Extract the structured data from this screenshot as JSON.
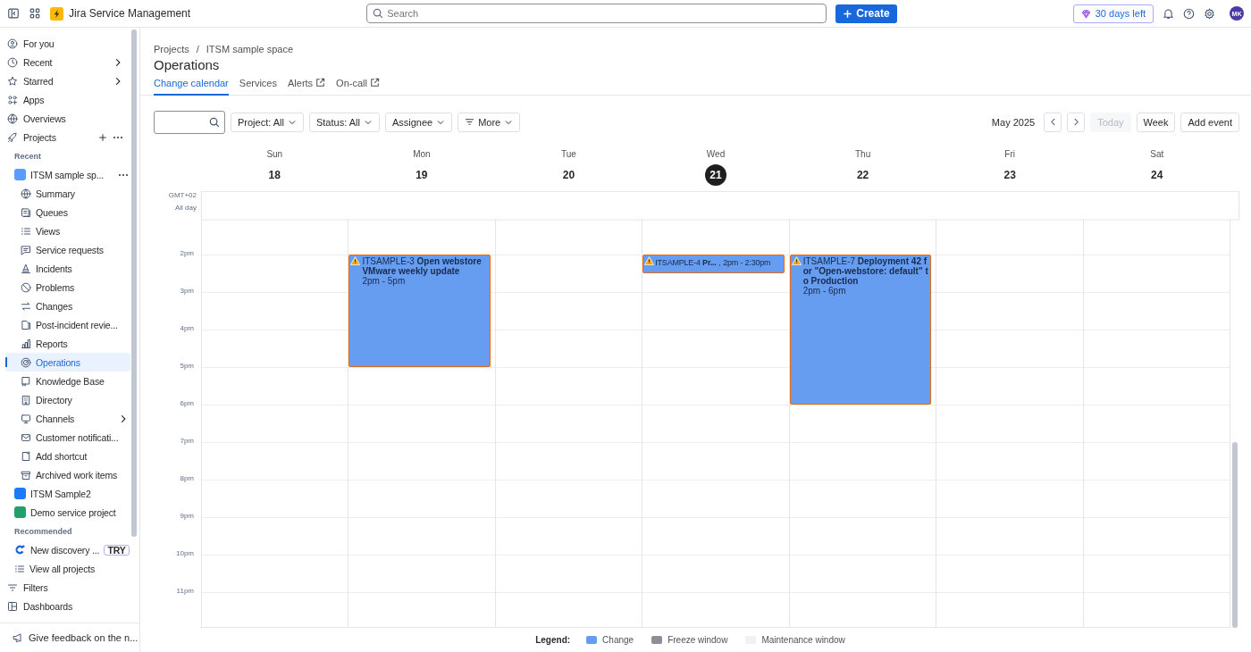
{
  "topbar": {
    "app_name": "Jira Service Management",
    "search": {
      "placeholder": "Search"
    },
    "create_label": "Create",
    "trial_label": "30 days left",
    "avatar_initials": "MK"
  },
  "sidebar": {
    "nav": [
      {
        "label": "For you",
        "chevron": false
      },
      {
        "label": "Recent",
        "chevron": true
      },
      {
        "label": "Starred",
        "chevron": true
      },
      {
        "label": "Apps",
        "chevron": false
      },
      {
        "label": "Overviews",
        "chevron": false
      }
    ],
    "projects_label": "Projects",
    "sections": [
      {
        "heading": "Recent",
        "projects": [
          {
            "label": "ITSM sample sp...",
            "children": [
              {
                "label": "Summary",
                "selected": false,
                "chevron": false
              },
              {
                "label": "Queues",
                "selected": false,
                "chevron": false
              },
              {
                "label": "Views",
                "selected": false,
                "chevron": false
              },
              {
                "label": "Service requests",
                "selected": false,
                "chevron": false
              },
              {
                "label": "Incidents",
                "selected": false,
                "chevron": false
              },
              {
                "label": "Problems",
                "selected": false,
                "chevron": false
              },
              {
                "label": "Changes",
                "selected": false,
                "chevron": false
              },
              {
                "label": "Post-incident revie...",
                "selected": false,
                "chevron": false
              },
              {
                "label": "Reports",
                "selected": false,
                "chevron": false
              },
              {
                "label": "Operations",
                "selected": true,
                "chevron": false
              },
              {
                "label": "Knowledge Base",
                "selected": false,
                "chevron": false
              },
              {
                "label": "Directory",
                "selected": false,
                "chevron": false
              },
              {
                "label": "Channels",
                "selected": false,
                "chevron": true
              },
              {
                "label": "Customer notificati...",
                "selected": false,
                "chevron": false
              },
              {
                "label": "Add shortcut",
                "selected": false,
                "chevron": false
              },
              {
                "label": "Archived work items",
                "selected": false,
                "chevron": false
              }
            ]
          },
          {
            "label": "ITSM Sample2"
          },
          {
            "label": "Demo service project"
          }
        ]
      },
      {
        "heading": "Recommended",
        "projects": [
          {
            "label": "New discovery ...",
            "badge": "TRY"
          },
          {
            "label": "View all projects"
          }
        ]
      }
    ],
    "bottom": [
      {
        "label": "Filters"
      },
      {
        "label": "Dashboards"
      }
    ],
    "feedback": "Give feedback on the n..."
  },
  "page": {
    "breadcrumbs": [
      "Projects",
      "ITSM sample space"
    ],
    "breadcrumb_separator": "/",
    "title": "Operations",
    "tabs": [
      {
        "label": "Change calendar",
        "selected": true,
        "external": false
      },
      {
        "label": "Services",
        "selected": false,
        "external": false
      },
      {
        "label": "Alerts",
        "selected": false,
        "external": true
      },
      {
        "label": "On-call",
        "selected": false,
        "external": true
      }
    ]
  },
  "toolbar": {
    "filters": [
      "Project: All",
      "Status: All",
      "Assignee",
      "More"
    ],
    "month": "May 2025",
    "today": {
      "label": "Today",
      "disabled": true
    },
    "view": "Week",
    "add_event": "Add event"
  },
  "calendar": {
    "timezone": "GMT+02",
    "all_day_label": "All day",
    "hours": [
      "2pm",
      "3pm",
      "4pm",
      "5pm",
      "6pm",
      "7pm",
      "8pm",
      "9pm",
      "10pm",
      "11pm"
    ],
    "days": [
      {
        "weekday": "Sun",
        "date": "18",
        "today": false
      },
      {
        "weekday": "Mon",
        "date": "19",
        "today": false,
        "events": [
          {
            "kind": "full",
            "label": "ITSAMPLE-3 **Open webstore VMware weekly update**",
            "time": "2pm - 5pm"
          }
        ]
      },
      {
        "weekday": "Tue",
        "date": "20",
        "today": false
      },
      {
        "weekday": "Wed",
        "date": "21",
        "today": true,
        "events": [
          {
            "kind": "compact",
            "label": "ITSAMPLE-4 **Pr...** ,",
            "time": "2pm - 2:30pm"
          }
        ]
      },
      {
        "weekday": "Thu",
        "date": "22",
        "today": false,
        "events": [
          {
            "kind": "full",
            "label": "ITSAMPLE-7 **Deployment 42 for \"Open-webstore: default\" to Production**",
            "time": "2pm - 6pm"
          }
        ]
      },
      {
        "weekday": "Fri",
        "date": "23",
        "today": false
      },
      {
        "weekday": "Sat",
        "date": "24",
        "today": false
      }
    ]
  },
  "legend": {
    "label": "Legend:",
    "items": [
      {
        "label": "Change",
        "color": "#669df1"
      },
      {
        "label": "Freeze window",
        "color": "#8c8f97"
      },
      {
        "label": "Maintenance window",
        "color": "#f0f1f2"
      }
    ]
  }
}
